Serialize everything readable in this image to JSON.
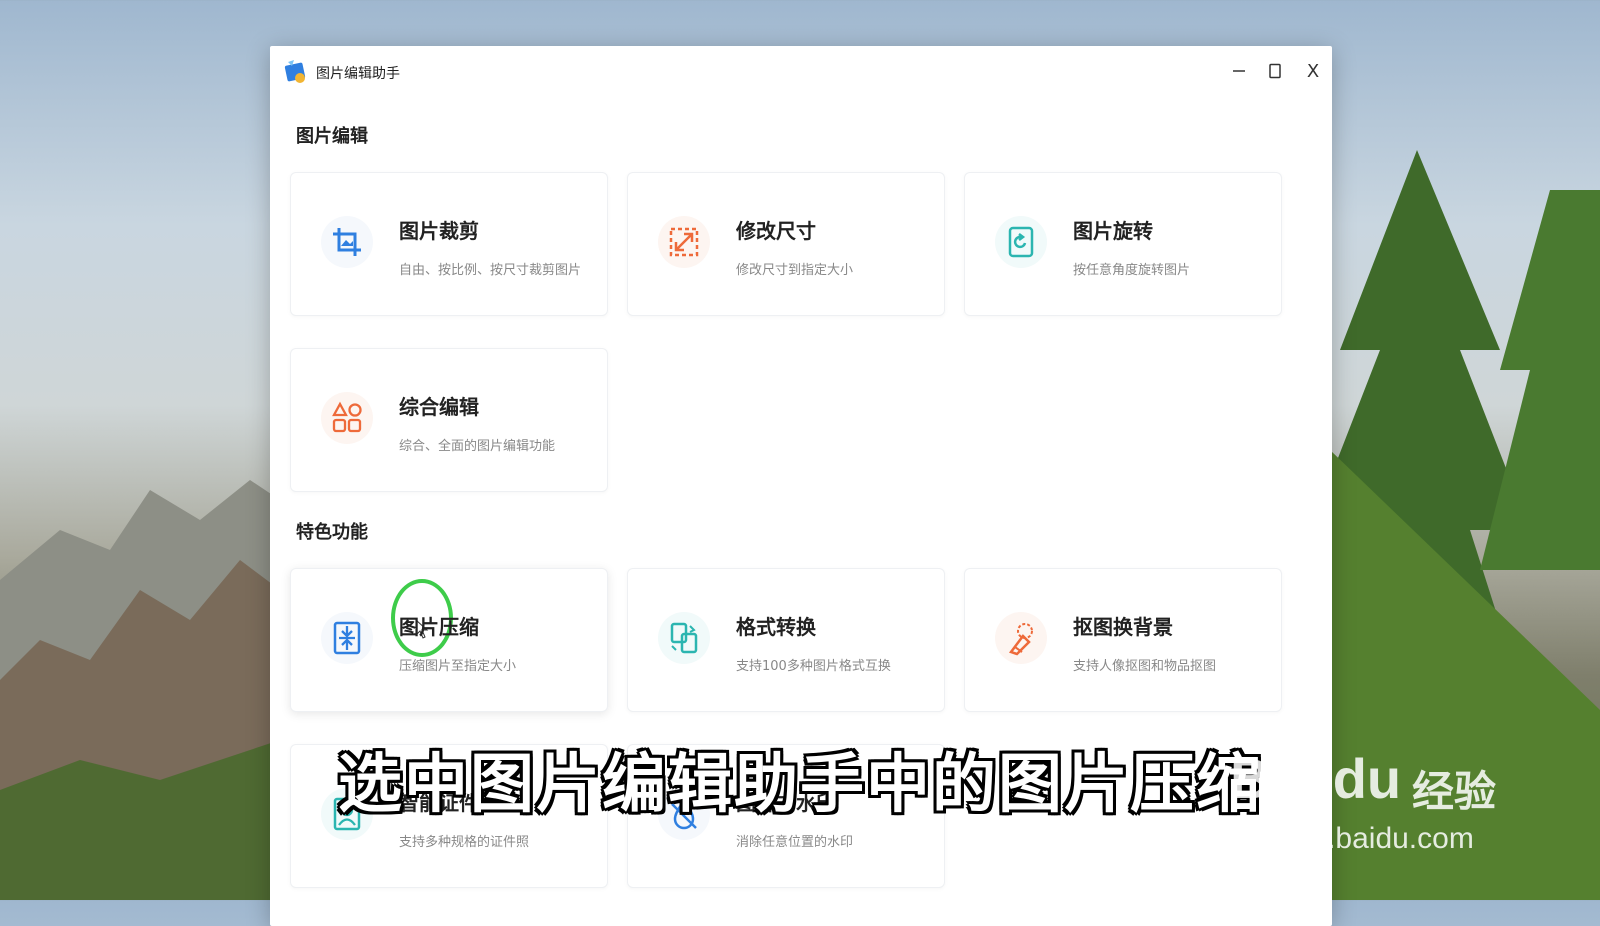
{
  "window": {
    "title": "图片编辑助手",
    "close_label": "X"
  },
  "sections": {
    "edit_title": "图片编辑",
    "feature_title": "特色功能"
  },
  "cards": {
    "crop": {
      "name": "图片裁剪",
      "desc": "自由、按比例、按尺寸裁剪图片",
      "icon": "crop-icon"
    },
    "resize": {
      "name": "修改尺寸",
      "desc": "修改尺寸到指定大小",
      "icon": "resize-icon"
    },
    "rotate": {
      "name": "图片旋转",
      "desc": "按任意角度旋转图片",
      "icon": "rotate-icon"
    },
    "general": {
      "name": "综合编辑",
      "desc": "综合、全面的图片编辑功能",
      "icon": "shapes-icon"
    },
    "compress": {
      "name": "图片压缩",
      "desc": "压缩图片至指定大小",
      "icon": "compress-icon"
    },
    "convert": {
      "name": "格式转换",
      "desc": "支持100多种图片格式互换",
      "icon": "convert-icon"
    },
    "cutout": {
      "name": "抠图换背景",
      "desc": "支持人像抠图和物品抠图",
      "icon": "cutout-icon"
    },
    "idphoto": {
      "name": "智能证件照",
      "desc": "支持多种规格的证件照",
      "icon": "id-photo-icon"
    },
    "watermark": {
      "name": "图片去水印",
      "desc": "消除任意位置的水印",
      "icon": "remove-watermark-icon"
    }
  },
  "overlay": {
    "subtitle": "选中图片编辑助手中的图片压缩",
    "brand": "Bai du",
    "brand_suffix": "经验",
    "url": "jingyan.baidu.com"
  },
  "colors": {
    "blue": "#2f7fe0",
    "orange": "#ee6a3a",
    "teal": "#2bb5b0",
    "highlight_ring": "#3ecc4a"
  }
}
